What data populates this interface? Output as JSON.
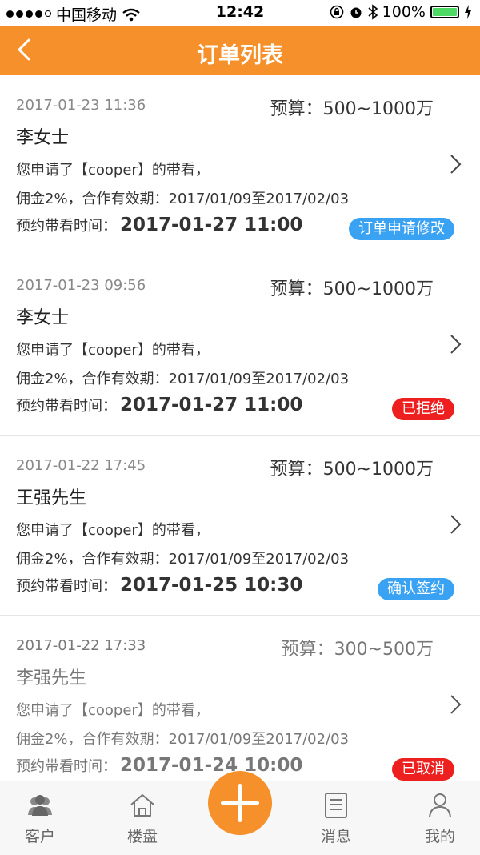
{
  "status_bar": {
    "carrier": "中国移动",
    "time": "12:42",
    "battery": "100%"
  },
  "header": {
    "title": "订单列表"
  },
  "orders": [
    {
      "created": "2017-01-23 11:36",
      "budget": "预算：500~1000万",
      "customer": "李女士",
      "request": "您申请了【cooper】的带看，",
      "commission": "佣金2%，合作有效期：2017/01/09至2017/02/03",
      "visit_label": "预约带看时间：",
      "visit_time": "2017-01-27 11:00",
      "status": "订单申请修改",
      "status_color": "#3aa2f3"
    },
    {
      "created": "2017-01-23 09:56",
      "budget": "预算：500~1000万",
      "customer": "李女士",
      "request": "您申请了【cooper】的带看，",
      "commission": "佣金2%，合作有效期：2017/01/09至2017/02/03",
      "visit_label": "预约带看时间：",
      "visit_time": "2017-01-27 11:00",
      "status": "已拒绝",
      "status_color": "#ee1f1f"
    },
    {
      "created": "2017-01-22 17:45",
      "budget": "预算：500~1000万",
      "customer": "王强先生",
      "request": "您申请了【cooper】的带看，",
      "commission": "佣金2%，合作有效期：2017/01/09至2017/02/03",
      "visit_label": "预约带看时间：",
      "visit_time": "2017-01-25 10:30",
      "status": "确认签约",
      "status_color": "#3aa2f3"
    },
    {
      "created": "2017-01-22 17:33",
      "budget": "预算：300~500万",
      "customer": "李强先生",
      "request": "您申请了【cooper】的带看，",
      "commission": "佣金2%，合作有效期：2017/01/09至2017/02/03",
      "visit_label": "预约带看时间：",
      "visit_time": "2017-01-24 10:00",
      "status": "已取消",
      "status_color": "#ee1f1f"
    }
  ],
  "tabs": {
    "customers": "客户",
    "properties": "楼盘",
    "messages": "消息",
    "mine": "我的"
  },
  "colors": {
    "accent": "#f5902a",
    "blue_badge": "#3aa2f3",
    "red_badge": "#ee1f1f"
  }
}
